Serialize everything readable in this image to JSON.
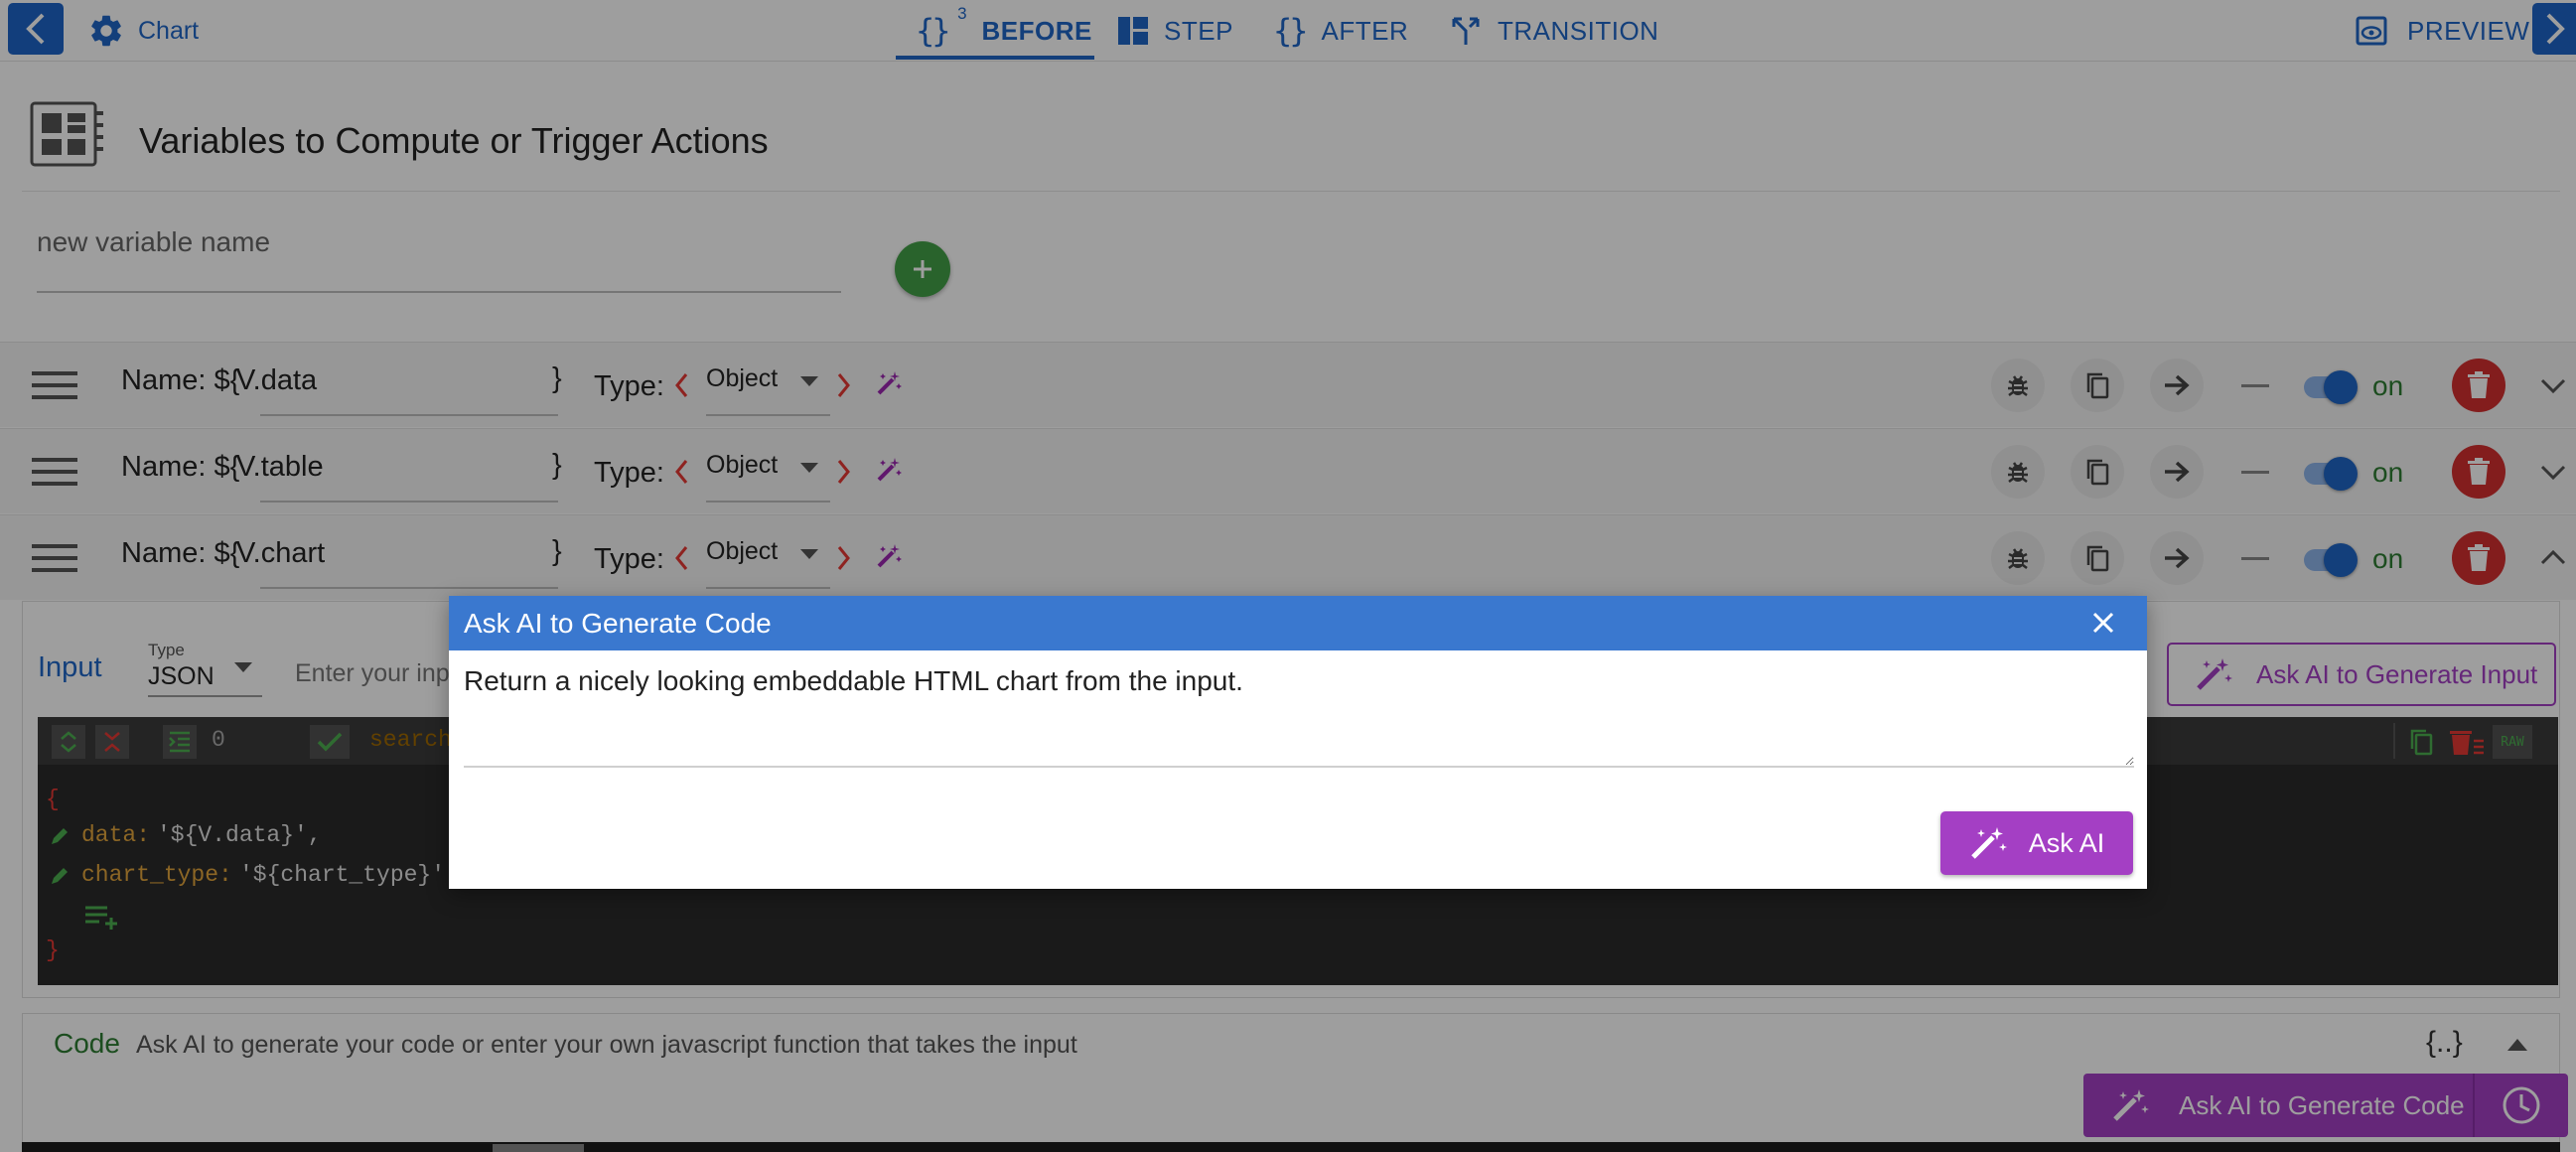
{
  "topbar": {
    "title": "Chart",
    "tabs": [
      {
        "label": "BEFORE",
        "sup": "3",
        "active": true
      },
      {
        "label": "STEP"
      },
      {
        "label": "AFTER"
      },
      {
        "label": "TRANSITION"
      }
    ],
    "preview_label": "PREVIEW"
  },
  "section": {
    "title": "Variables to Compute or Trigger Actions",
    "new_var_placeholder": "new variable name"
  },
  "variables": [
    {
      "name_prefix": "Name: ${",
      "name": "V.data",
      "name_suffix": "}",
      "type_label": "Type:",
      "type": "Object",
      "status": "on",
      "expanded": false
    },
    {
      "name_prefix": "Name: ${",
      "name": "V.table",
      "name_suffix": "}",
      "type_label": "Type:",
      "type": "Object",
      "status": "on",
      "expanded": false
    },
    {
      "name_prefix": "Name: ${",
      "name": "V.chart",
      "name_suffix": "}",
      "type_label": "Type:",
      "type": "Object",
      "status": "on",
      "expanded": true
    }
  ],
  "input": {
    "label": "Input",
    "type_label": "Type",
    "type": "JSON",
    "placeholder": "Enter your inp",
    "ask_ai_label": "Ask AI to Generate Input",
    "editor": {
      "count": "0",
      "search_placeholder": "search",
      "raw_label": "RAW",
      "open_brace": "{",
      "lines": [
        {
          "key": "data:",
          "value": "'${V.data}',"
        },
        {
          "key": "chart_type:",
          "value": "'${chart_type}'"
        }
      ],
      "close_brace": "}"
    }
  },
  "code": {
    "label": "Code",
    "hint": "Ask AI to generate your code or enter your own javascript function that takes the input",
    "braces": "{..}",
    "ask_ai_label": "Ask AI to Generate Code"
  },
  "modal": {
    "title": "Ask AI to Generate Code",
    "prompt": "Return a nicely looking embeddable HTML chart from the input.",
    "ask_button": "Ask AI"
  },
  "colors": {
    "primary": "#1f66c7",
    "purple": "#a43fc4",
    "green": "#43a047",
    "red": "#d32f2f",
    "modal_header": "#3a78cf"
  }
}
